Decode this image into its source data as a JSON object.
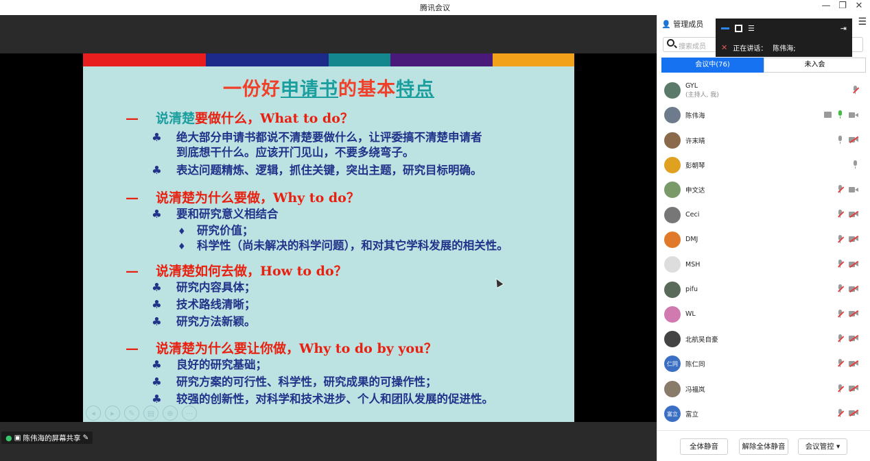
{
  "window": {
    "title": "腾讯会议",
    "minimize": "—",
    "restore": "❐",
    "close": "✕"
  },
  "slide": {
    "title_parts": [
      "一份好",
      "申请书",
      "的基本",
      "特点"
    ],
    "sections": [
      {
        "prefix": "说清楚",
        "text": "要做什么，What to do？",
        "bullets": [
          {
            "kind": "club",
            "text": "绝大部分申请书都说不清楚要做什么，让评委搞不清楚申请者",
            "cont": "到底想干什么。应该开门见山，不要多绕弯子。"
          },
          {
            "kind": "club",
            "text": "表达问题精炼、逻辑，抓住关键，突出主题，研究目标明确。"
          }
        ]
      },
      {
        "prefix": "",
        "text": "说清楚为什么要做，Why to do？",
        "bullets": [
          {
            "kind": "club",
            "text": "要和研究意义相结合"
          },
          {
            "kind": "diamond",
            "text": "研究价值；"
          },
          {
            "kind": "diamond",
            "text": "科学性（尚未解决的科学问题），和对其它学科发展的相关性。"
          }
        ]
      },
      {
        "prefix": "",
        "text": "说清楚如何去做，How to do？",
        "bullets": [
          {
            "kind": "club",
            "text": "研究内容具体；"
          },
          {
            "kind": "club",
            "text": "技术路线清晰；"
          },
          {
            "kind": "club",
            "text": "研究方法新颖。"
          }
        ]
      },
      {
        "prefix": "",
        "text": "说清楚为什么要让你做，Why to do by you？",
        "bullets": [
          {
            "kind": "club",
            "text": "良好的研究基础；"
          },
          {
            "kind": "club",
            "text": "研究方案的可行性、科学性，研究成果的可操作性；"
          },
          {
            "kind": "club",
            "text": "较强的创新性，对科学和技术进步、个人和团队发展的促进性。"
          }
        ]
      }
    ],
    "colors": {
      "bar": [
        "#e81e1e",
        "#1e2a8a",
        "#14868e",
        "#4a1a7a",
        "#f2a21a"
      ],
      "title": "#f0402a",
      "accent": "#1a9e9e",
      "heading": "#e8200f",
      "body": "#22338a",
      "bg": "#bde2e2"
    }
  },
  "share_badge": "陈伟海的屏幕共享",
  "panel": {
    "header": "管理成员",
    "search_placeholder": "搜索成员",
    "speaking_label": "正在讲话：",
    "speaking_name": "陈伟海;",
    "tabs": [
      "会议中(76)",
      "未入会"
    ],
    "members": [
      {
        "name": "GYL",
        "sub": "(主持人, 我)",
        "avatar_color": "#5b7a6a",
        "avatar_text": "",
        "mic": "muted",
        "cam": "none",
        "screen": false
      },
      {
        "name": "陈伟海",
        "sub": "",
        "avatar_color": "#6d7b8c",
        "avatar_text": "",
        "mic": "green",
        "cam": "on",
        "screen": true
      },
      {
        "name": "许末晴",
        "sub": "",
        "avatar_color": "#8a6a4a",
        "avatar_text": "",
        "mic": "on",
        "cam": "off",
        "screen": false
      },
      {
        "name": "彭朝琴",
        "sub": "",
        "avatar_color": "#e0a020",
        "avatar_text": "",
        "mic": "on",
        "cam": "none",
        "screen": false
      },
      {
        "name": "申文达",
        "sub": "",
        "avatar_color": "#7a9a6a",
        "avatar_text": "",
        "mic": "muted",
        "cam": "on",
        "screen": false
      },
      {
        "name": "Ceci",
        "sub": "",
        "avatar_color": "#777777",
        "avatar_text": "",
        "mic": "muted",
        "cam": "off",
        "screen": false
      },
      {
        "name": "DMJ",
        "sub": "",
        "avatar_color": "#e07a2a",
        "avatar_text": "",
        "mic": "muted",
        "cam": "off",
        "screen": false
      },
      {
        "name": "MSH",
        "sub": "",
        "avatar_color": "#dddddd",
        "avatar_text": "",
        "mic": "muted",
        "cam": "off",
        "screen": false
      },
      {
        "name": "pifu",
        "sub": "",
        "avatar_color": "#5a6a5a",
        "avatar_text": "",
        "mic": "muted",
        "cam": "off",
        "screen": false
      },
      {
        "name": "WL",
        "sub": "",
        "avatar_color": "#d07ab0",
        "avatar_text": "",
        "mic": "muted",
        "cam": "off",
        "screen": false
      },
      {
        "name": "北航吴自豪",
        "sub": "",
        "avatar_color": "#444444",
        "avatar_text": "",
        "mic": "muted",
        "cam": "off",
        "screen": false
      },
      {
        "name": "陈仁同",
        "sub": "",
        "avatar_color": "#3a6fc4",
        "avatar_text": "仁同",
        "mic": "muted",
        "cam": "off",
        "screen": false
      },
      {
        "name": "冯福岚",
        "sub": "",
        "avatar_color": "#8a7a6a",
        "avatar_text": "",
        "mic": "muted",
        "cam": "off",
        "screen": false
      },
      {
        "name": "富立",
        "sub": "",
        "avatar_color": "#3a6fc4",
        "avatar_text": "富立",
        "mic": "muted",
        "cam": "off",
        "screen": false
      }
    ],
    "buttons": {
      "mute_all": "全体静音",
      "unmute_all": "解除全体静音",
      "meeting_control": "会议管控 ▾"
    }
  }
}
